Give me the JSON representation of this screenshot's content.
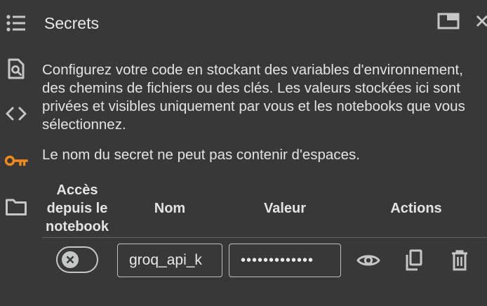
{
  "panel": {
    "title": "Secrets"
  },
  "icons": {
    "menu": "list-icon",
    "inspect": "document-search-icon",
    "code": "code-brackets-icon",
    "secrets": "key-icon",
    "files": "folder-icon",
    "dock": "dock-window-icon",
    "close": "close-icon"
  },
  "description": {
    "lines": [
      "Configurez votre code en stockant des variables d'environnement,",
      "des chemins de fichiers ou des clés. Les valeurs stockées ici sont",
      "privées et visibles uniquement par vous et les notebooks que vous",
      "sélectionnez."
    ]
  },
  "warning": "Le nom du secret ne peut pas contenir d'espaces.",
  "table": {
    "headers": {
      "access": [
        "Accès",
        "depuis le",
        "notebook"
      ],
      "name": "Nom",
      "value": "Valeur",
      "actions": "Actions"
    },
    "rows": [
      {
        "access_enabled": false,
        "name": "groq_api_k",
        "value": "•••••••••••••"
      }
    ]
  },
  "colors": {
    "background": "#383838",
    "text": "#e3e3e3",
    "accent_key": "#f28b1e",
    "border": "#bdc1c6"
  }
}
